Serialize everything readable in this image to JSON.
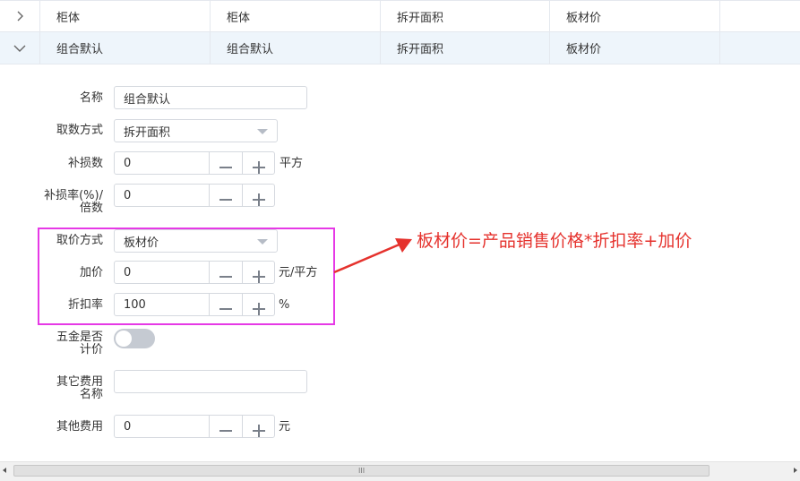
{
  "table": {
    "rows": [
      {
        "expanded": false,
        "cells": [
          "柜体",
          "柜体",
          "拆开面积",
          "板材价",
          ""
        ]
      },
      {
        "expanded": true,
        "cells": [
          "组合默认",
          "组合默认",
          "拆开面积",
          "板材价",
          ""
        ]
      }
    ]
  },
  "form": {
    "name": {
      "label": "名称",
      "value": "组合默认"
    },
    "fetch_method": {
      "label": "取数方式",
      "value": "拆开面积"
    },
    "loss_amount": {
      "label": "补损数",
      "value": "0",
      "unit": "平方"
    },
    "loss_rate": {
      "label_line1": "补损率(%)/",
      "label_line2": "倍数",
      "value": "0"
    },
    "price_method": {
      "label": "取价方式",
      "value": "板材价"
    },
    "markup": {
      "label": "加价",
      "value": "0",
      "unit": "元/平方"
    },
    "discount_rate": {
      "label": "折扣率",
      "value": "100",
      "unit": "%"
    },
    "hardware_priced": {
      "label_line1": "五金是否",
      "label_line2": "计价",
      "on": false
    },
    "other_fee_name": {
      "label_line1": "其它费用",
      "label_line2": "名称",
      "value": ""
    },
    "other_fee": {
      "label": "其他费用",
      "value": "0",
      "unit": "元"
    }
  },
  "annotation": {
    "text": "板材价=产品销售价格*折扣率+加价",
    "color": "#e5322d",
    "box_color": "#e639e6"
  },
  "scrollbar": {
    "grip": "III"
  }
}
